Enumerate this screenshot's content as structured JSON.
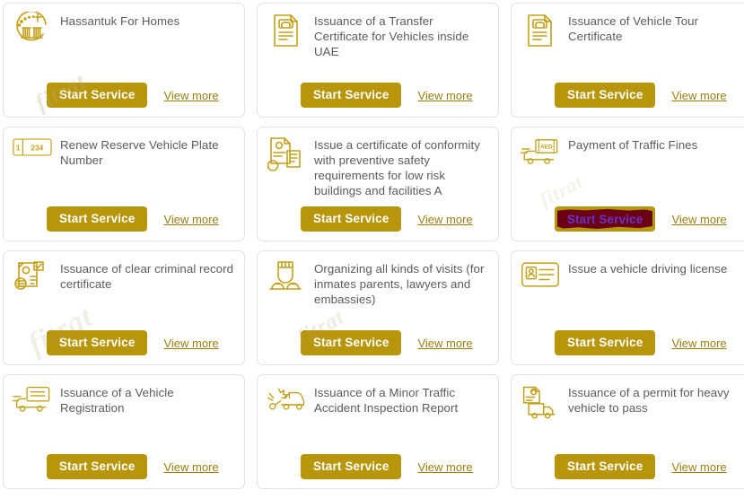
{
  "page": {
    "title": "Government Services Grid",
    "accent_color": "#b8960c",
    "icon_color": "#c3a01a",
    "title_color": "#5b5b5b",
    "link_color": "#9a7f10",
    "selected_button_bg": "#6b0014",
    "selected_button_text_color": "#6633cc",
    "card_border_color": "#e2e2e2"
  },
  "labels": {
    "start_service": "Start Service",
    "view_more": "View more"
  },
  "watermarks": {
    "a": "fitrat",
    "b": "fitrat",
    "c": "fitrat",
    "d": "fitrat"
  },
  "plate_icon": {
    "emirate_code": "1",
    "number": "234"
  },
  "money_icon": {
    "currency": "AED"
  },
  "cards": [
    {
      "id": "hassantuk-for-homes",
      "title": "Hassantuk For Homes",
      "icon": "hassantuk-logo-icon",
      "start_label": "Start Service",
      "view_label": "View more",
      "selected": false
    },
    {
      "id": "transfer-certificate-vehicles-inside-uae",
      "title": "Issuance of a Transfer Certificate for Vehicles inside UAE",
      "icon": "vehicle-document-icon",
      "start_label": "Start Service",
      "view_label": "View more",
      "selected": false
    },
    {
      "id": "vehicle-tour-certificate",
      "title": "Issuance of Vehicle Tour Certificate",
      "icon": "vehicle-document-icon",
      "start_label": "Start Service",
      "view_label": "View more",
      "selected": false
    },
    {
      "id": "renew-reserve-vehicle-plate-number",
      "title": "Renew Reserve Vehicle Plate Number",
      "icon": "license-plate-icon",
      "start_label": "Start Service",
      "view_label": "View more",
      "selected": false
    },
    {
      "id": "certificate-of-conformity-preventive-safety",
      "title": "Issue a certificate of conformity with preventive safety requirements for low risk buildings and facilities A",
      "icon": "certificate-documents-icon",
      "start_label": "Start Service",
      "view_label": "View more",
      "selected": false
    },
    {
      "id": "payment-of-traffic-fines",
      "title": "Payment of Traffic Fines",
      "icon": "car-banknote-icon",
      "start_label": "Start Service",
      "view_label": "View more",
      "selected": true
    },
    {
      "id": "clear-criminal-record-certificate",
      "title": "Issuance of clear criminal record certificate",
      "icon": "criminal-record-icon",
      "start_label": "Start Service",
      "view_label": "View more",
      "selected": false
    },
    {
      "id": "organizing-visits-inmates",
      "title": "Organizing all kinds of visits (for inmates parents, lawyers and embassies)",
      "icon": "inmate-person-icon",
      "start_label": "Start Service",
      "view_label": "View more",
      "selected": false
    },
    {
      "id": "vehicle-driving-license",
      "title": "Issue a vehicle driving license",
      "icon": "id-card-icon",
      "start_label": "Start Service",
      "view_label": "View more",
      "selected": false
    },
    {
      "id": "vehicle-registration",
      "title": "Issuance of a Vehicle Registration",
      "icon": "car-card-icon",
      "start_label": "Start Service",
      "view_label": "View more",
      "selected": false
    },
    {
      "id": "minor-traffic-accident-inspection-report",
      "title": "Issuance of a Minor Traffic Accident Inspection Report",
      "icon": "car-collision-icon",
      "start_label": "Start Service",
      "view_label": "View more",
      "selected": false
    },
    {
      "id": "permit-heavy-vehicle-to-pass",
      "title": "Issuance of a permit for heavy vehicle to pass",
      "icon": "truck-permit-icon",
      "start_label": "Start Service",
      "view_label": "View more",
      "selected": false
    }
  ]
}
